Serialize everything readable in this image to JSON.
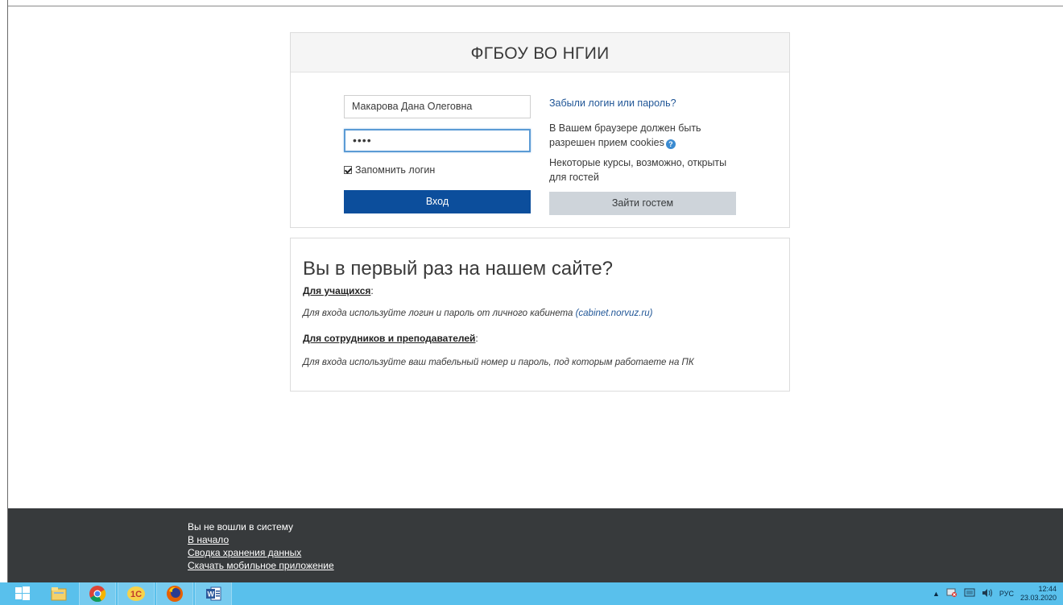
{
  "login": {
    "site_title": "ФГБОУ ВО НГИИ",
    "username_value": "Макарова Дана Олеговна",
    "password_mask": "••••",
    "remember_label": "Запомнить логин",
    "remember_checked": true,
    "login_button": "Вход",
    "forgot_link": "Забыли логин или пароль?",
    "cookies_notice": "В Вашем браузере должен быть разрешен прием cookies",
    "guests_notice": "Некоторые курсы, возможно, открыты для гостей",
    "guest_button": "Зайти гостем"
  },
  "first_time": {
    "heading": "Вы в первый раз на нашем сайте?",
    "students_title": "Для учащихся",
    "students_note": "Для входа используйте логин и пароль от личного кабинета",
    "cabinet_link": "(cabinet.norvuz.ru)",
    "staff_title": "Для сотрудников и преподавателей",
    "staff_note": "Для входа используйте ваш табельный номер и пароль, под которым работаете на ПК"
  },
  "footer": {
    "status": "Вы не вошли в систему",
    "home_link": "В начало",
    "data_link": "Сводка хранения данных",
    "app_link": "Скачать мобильное приложение"
  },
  "taskbar": {
    "apps": [
      "windows-start-icon",
      "file-explorer-icon",
      "chrome-icon",
      "1c-icon",
      "firefox-icon",
      "word-icon"
    ],
    "language": "РУС",
    "time": "12:44",
    "date": "23.03.2020"
  },
  "colors": {
    "primary_button": "#0c4e9c",
    "secondary_button": "#ced4da",
    "footer_bg": "#373a3c",
    "taskbar_bg": "#59c0ec",
    "link": "#1f5596"
  }
}
